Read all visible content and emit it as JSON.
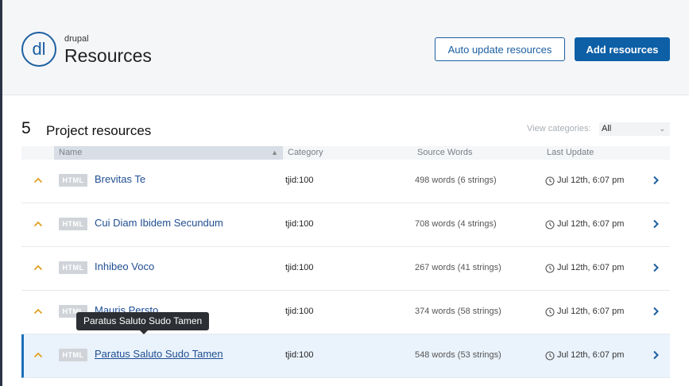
{
  "header": {
    "logo_text": "dl",
    "project_name": "drupal",
    "title": "Resources",
    "auto_update_label": "Auto update resources",
    "add_label": "Add resources"
  },
  "section": {
    "count": "5",
    "title": "Project resources",
    "view_label": "View categories:",
    "view_value": "All"
  },
  "table": {
    "columns": [
      "Name",
      "Category",
      "Source Words",
      "Last Update"
    ],
    "rows": [
      {
        "badge": "HTML",
        "name": "Brevitas Te",
        "category": "tjid:100",
        "words": "498 words (6 strings)",
        "updated": "Jul 12th, 6:07 pm"
      },
      {
        "badge": "HTML",
        "name": "Cui Diam Ibidem Secundum",
        "category": "tjid:100",
        "words": "708 words (4 strings)",
        "updated": "Jul 12th, 6:07 pm"
      },
      {
        "badge": "HTML",
        "name": "Inhibeo Voco",
        "category": "tjid:100",
        "words": "267 words (41 strings)",
        "updated": "Jul 12th, 6:07 pm"
      },
      {
        "badge": "HTML",
        "name": "Mauris Persto",
        "category": "tjid:100",
        "words": "374 words (58 strings)",
        "updated": "Jul 12th, 6:07 pm"
      },
      {
        "badge": "HTML",
        "name": " Paratus Saluto Sudo Tamen",
        "category": "tjid:100",
        "words": "548 words (53 strings)",
        "updated": "Jul 12th, 6:07 pm"
      }
    ]
  },
  "tooltip": {
    "text": "Paratus Saluto Sudo Tamen"
  },
  "colors": {
    "accent": "#0d5fa6",
    "link": "#1f4e91",
    "chevron": "#e0a020",
    "selected_row": "#eaf3fc"
  }
}
